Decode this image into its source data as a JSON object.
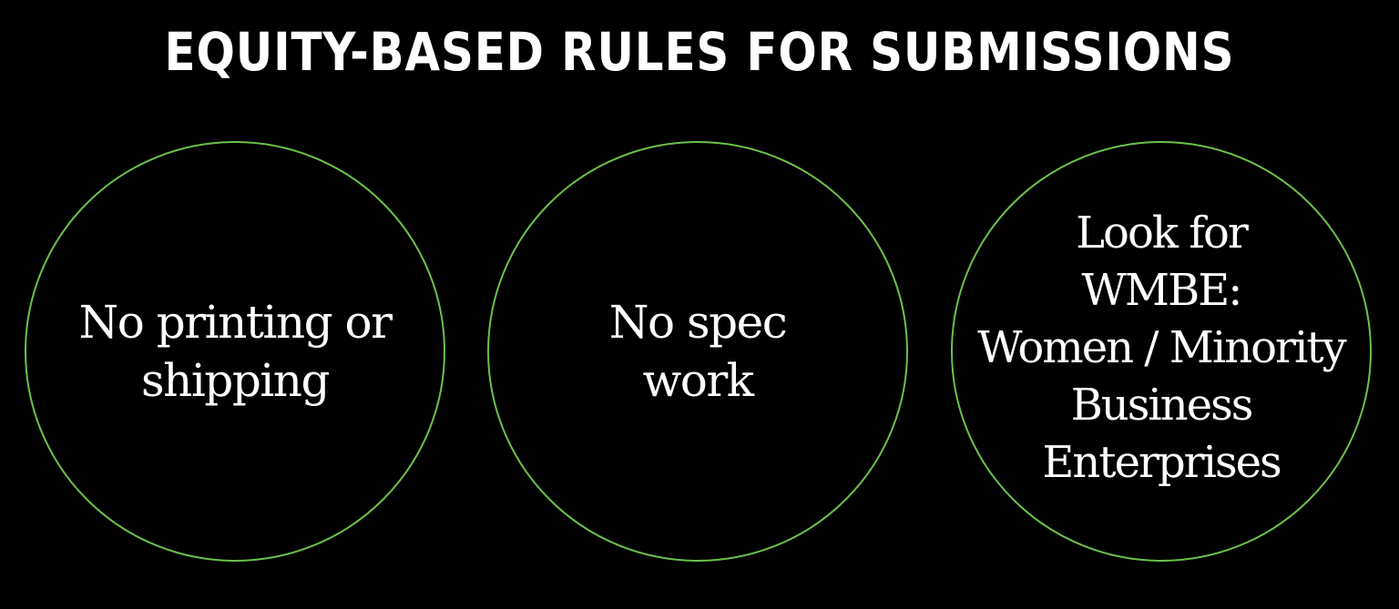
{
  "title": "EQUITY-BASED RULES FOR SUBMISSIONS",
  "colors": {
    "background": "#000000",
    "text": "#ffffff",
    "circle_border": "#6cc04a"
  },
  "rules": [
    {
      "text": "No printing or\nshipping"
    },
    {
      "text": "No spec\nwork"
    },
    {
      "text": "Look for\nWMBE:\nWomen / Minority\nBusiness\nEnterprises"
    }
  ]
}
